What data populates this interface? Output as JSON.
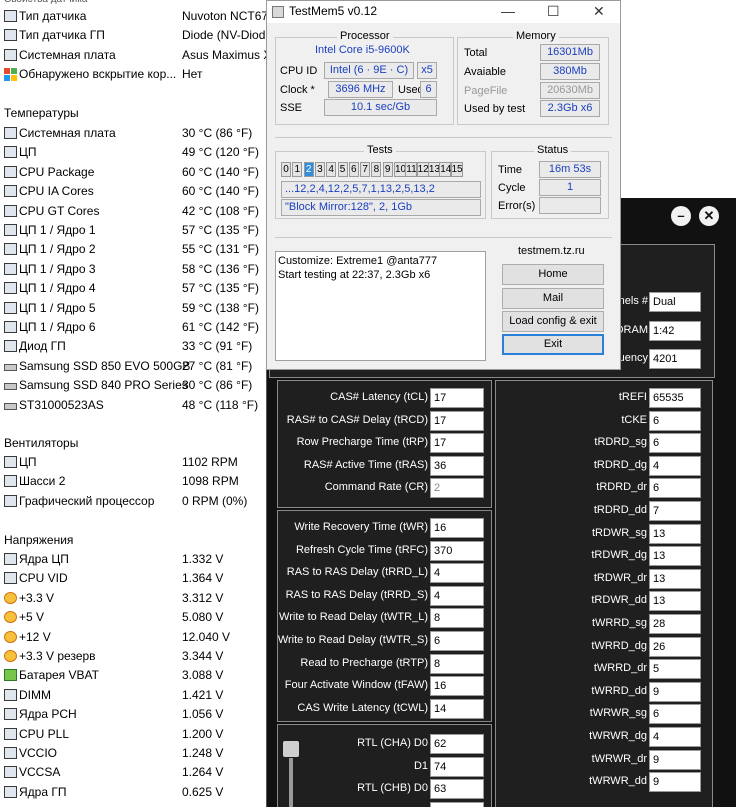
{
  "left_panel": {
    "top_cut_label": "Свойства датчика",
    "sensor_props": [
      {
        "name": "Тип датчика",
        "value": "Nuvoton NCT67",
        "icon": "chip-icon"
      },
      {
        "name": "Тип датчика ГП",
        "value": "Diode  (NV-Diod",
        "icon": "chip-icon"
      },
      {
        "name": "Системная плата",
        "value": "Asus Maximus X",
        "icon": "motherboard-icon"
      },
      {
        "name": "Обнаружено вскрытие кор...",
        "value": "Нет",
        "icon": "shield-icon"
      }
    ],
    "temps_header": "Температуры",
    "temps": [
      {
        "name": "Системная плата",
        "value": "30 °C  (86 °F)",
        "icon": "motherboard-icon"
      },
      {
        "name": "ЦП",
        "value": "49 °C  (120 °F)",
        "icon": "cpu-icon"
      },
      {
        "name": "CPU Package",
        "value": "60 °C  (140 °F)",
        "icon": "cpu-icon"
      },
      {
        "name": "CPU IA Cores",
        "value": "60 °C  (140 °F)",
        "icon": "cpu-icon"
      },
      {
        "name": "CPU GT Cores",
        "value": "42 °C  (108 °F)",
        "icon": "gpu-icon"
      },
      {
        "name": "ЦП 1 / Ядро 1",
        "value": "57 °C  (135 °F)",
        "icon": "cpu-icon"
      },
      {
        "name": "ЦП 1 / Ядро 2",
        "value": "55 °C  (131 °F)",
        "icon": "cpu-icon"
      },
      {
        "name": "ЦП 1 / Ядро 3",
        "value": "58 °C  (136 °F)",
        "icon": "cpu-icon"
      },
      {
        "name": "ЦП 1 / Ядро 4",
        "value": "57 °C  (135 °F)",
        "icon": "cpu-icon"
      },
      {
        "name": "ЦП 1 / Ядро 5",
        "value": "59 °C  (138 °F)",
        "icon": "cpu-icon"
      },
      {
        "name": "ЦП 1 / Ядро 6",
        "value": "61 °C  (142 °F)",
        "icon": "cpu-icon"
      },
      {
        "name": "Диод ГП",
        "value": "33 °C  (91 °F)",
        "icon": "gpu-icon"
      },
      {
        "name": "Samsung SSD 850 EVO 500GB",
        "value": "27 °C  (81 °F)",
        "icon": "drive-icon"
      },
      {
        "name": "Samsung SSD 840 PRO Series",
        "value": "30 °C  (86 °F)",
        "icon": "drive-icon"
      },
      {
        "name": "ST31000523AS",
        "value": "48 °C  (118 °F)",
        "icon": "drive-icon"
      }
    ],
    "fans_header": "Вентиляторы",
    "fans": [
      {
        "name": "ЦП",
        "value": "1102 RPM",
        "icon": "cpu-icon"
      },
      {
        "name": "Шасси 2",
        "value": "1098 RPM",
        "icon": "motherboard-icon"
      },
      {
        "name": "Графический процессор",
        "value": "0 RPM  (0%)",
        "icon": "gpu-icon"
      }
    ],
    "volts_header": "Напряжения",
    "volts": [
      {
        "name": "Ядра ЦП",
        "value": "1.332 V",
        "icon": "cpu-icon"
      },
      {
        "name": "CPU VID",
        "value": "1.364 V",
        "icon": "cpu-icon"
      },
      {
        "name": "+3.3 V",
        "value": "3.312 V",
        "icon": "voltage-icon"
      },
      {
        "name": "+5 V",
        "value": "5.080 V",
        "icon": "voltage-icon"
      },
      {
        "name": "+12 V",
        "value": "12.040 V",
        "icon": "voltage-icon"
      },
      {
        "name": "+3.3 V резерв",
        "value": "3.344 V",
        "icon": "voltage-icon"
      },
      {
        "name": "Батарея VBAT",
        "value": "3.088 V",
        "icon": "battery-icon"
      },
      {
        "name": "DIMM",
        "value": "1.421 V",
        "icon": "memory-icon"
      },
      {
        "name": "Ядра PCH",
        "value": "1.056 V",
        "icon": "chip-icon"
      },
      {
        "name": "CPU PLL",
        "value": "1.200 V",
        "icon": "cpu-icon"
      },
      {
        "name": "VCCIO",
        "value": "1.248 V",
        "icon": "cpu-icon"
      },
      {
        "name": "VCCSA",
        "value": "1.264 V",
        "icon": "cpu-icon"
      },
      {
        "name": "Ядра ГП",
        "value": "0.625 V",
        "icon": "gpu-icon"
      }
    ]
  },
  "testmem": {
    "title": "TestMem5 v0.12",
    "processor_title": "Processor",
    "cpu_name": "Intel Core i5-9600K",
    "cpu_id_label": "CPU ID",
    "cpu_id_value": "Intel  (6 · 9E · C)",
    "threads": "x5",
    "clock_label": "Clock *",
    "clock_value": "3696 MHz",
    "used_label": "Used",
    "used_value": "6",
    "sse_label": "SSE",
    "sse_value": "10.1 sec/Gb",
    "memory_title": "Memory",
    "total_label": "Total",
    "total_value": "16301Mb",
    "avail_label": "Avaiable",
    "avail_value": "380Mb",
    "pagefile_label": "PageFile",
    "pagefile_value": "20630Mb",
    "usedby_label": "Used by test",
    "usedby_value": "2.3Gb x6",
    "tests_title": "Tests",
    "test_cells": [
      "0",
      "1",
      "2",
      "3",
      "4",
      "5",
      "6",
      "7",
      "8",
      "9",
      "10",
      "11",
      "12",
      "13",
      "14",
      "15"
    ],
    "test_selected": 2,
    "sequence": "...12,2,4,12,2,5,7,1,13,2,5,13,2",
    "current_test": "\"Block Mirror:128\", 2, 1Gb",
    "status_title": "Status",
    "time_label": "Time",
    "time_value": "16m 53s",
    "cycle_label": "Cycle",
    "cycle_value": "1",
    "errors_label": "Error(s)",
    "errors_value": "",
    "log_line1": "Customize: Extreme1 @anta777",
    "log_line2": "Start testing at 22:37, 2.3Gb x6",
    "site": "testmem.tz.ru",
    "btn_home": "Home",
    "btn_mail": "Mail",
    "btn_load": "Load config & exit",
    "btn_exit": "Exit"
  },
  "timings": {
    "top": [
      {
        "label": "nels #",
        "value": "Dual"
      },
      {
        "label": "DRAM",
        "value": "1:42"
      },
      {
        "label": "uency",
        "value": "4201"
      }
    ],
    "group1": [
      {
        "label": "CAS# Latency (tCL)",
        "value": "17"
      },
      {
        "label": "RAS# to CAS# Delay (tRCD)",
        "value": "17"
      },
      {
        "label": "Row Precharge Time (tRP)",
        "value": "17"
      },
      {
        "label": "RAS# Active Time (tRAS)",
        "value": "36"
      },
      {
        "label": "Command Rate (CR)",
        "value": "2"
      }
    ],
    "group2": [
      {
        "label": "Write Recovery Time (tWR)",
        "value": "16"
      },
      {
        "label": "Refresh Cycle Time (tRFC)",
        "value": "370"
      },
      {
        "label": "RAS to RAS Delay (tRRD_L)",
        "value": "4"
      },
      {
        "label": "RAS to RAS Delay (tRRD_S)",
        "value": "4"
      },
      {
        "label": "Write to Read Delay (tWTR_L)",
        "value": "8"
      },
      {
        "label": "Write to Read Delay (tWTR_S)",
        "value": "6"
      },
      {
        "label": "Read to Precharge (tRTP)",
        "value": "8"
      },
      {
        "label": "Four Activate Window (tFAW)",
        "value": "16"
      },
      {
        "label": "CAS Write Latency (tCWL)",
        "value": "14"
      }
    ],
    "group3": [
      {
        "label": "RTL (CHA) D0",
        "value": "62"
      },
      {
        "label": "D1",
        "value": "74"
      },
      {
        "label": "RTL (CHB) D0",
        "value": "63"
      },
      {
        "label": "",
        "value": "74"
      }
    ],
    "right": [
      {
        "label": "tREFI",
        "value": "65535"
      },
      {
        "label": "tCKE",
        "value": "6"
      },
      {
        "label": "tRDRD_sg",
        "value": "6"
      },
      {
        "label": "tRDRD_dg",
        "value": "4"
      },
      {
        "label": "tRDRD_dr",
        "value": "6"
      },
      {
        "label": "tRDRD_dd",
        "value": "7"
      },
      {
        "label": "tRDWR_sg",
        "value": "13"
      },
      {
        "label": "tRDWR_dg",
        "value": "13"
      },
      {
        "label": "tRDWR_dr",
        "value": "13"
      },
      {
        "label": "tRDWR_dd",
        "value": "13"
      },
      {
        "label": "tWRRD_sg",
        "value": "28"
      },
      {
        "label": "tWRRD_dg",
        "value": "26"
      },
      {
        "label": "tWRRD_dr",
        "value": "5"
      },
      {
        "label": "tWRRD_dd",
        "value": "9"
      },
      {
        "label": "tWRWR_sg",
        "value": "6"
      },
      {
        "label": "tWRWR_dg",
        "value": "4"
      },
      {
        "label": "tWRWR_dr",
        "value": "9"
      },
      {
        "label": "tWRWR_dd",
        "value": "9"
      }
    ],
    "minimize_glyph": "–",
    "close_glyph": "✕"
  }
}
